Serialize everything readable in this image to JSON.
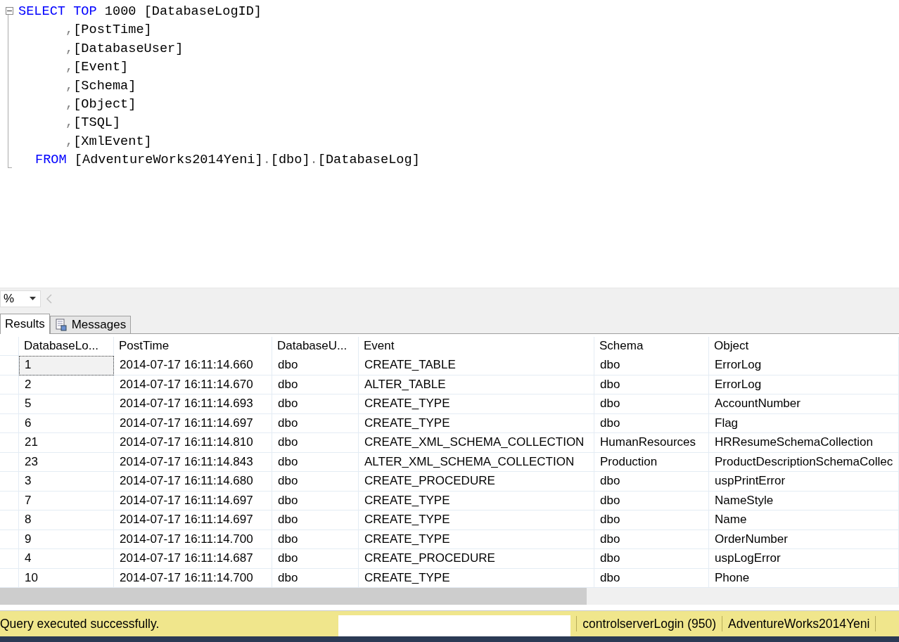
{
  "editor": {
    "lines": [
      {
        "kind": "head",
        "tokens": [
          {
            "kind": "keyword",
            "text": "SELECT"
          },
          {
            "kind": "keyword",
            "text": "TOP"
          },
          {
            "kind": "text",
            "text": "1000"
          },
          {
            "kind": "text",
            "text": "[DatabaseLogID]"
          }
        ]
      },
      {
        "kind": "column",
        "tokens": [
          {
            "kind": "punct",
            "text": ","
          },
          {
            "kind": "text",
            "text": "[PostTime]"
          }
        ]
      },
      {
        "kind": "column",
        "tokens": [
          {
            "kind": "punct",
            "text": ","
          },
          {
            "kind": "text",
            "text": "[DatabaseUser]"
          }
        ]
      },
      {
        "kind": "column",
        "tokens": [
          {
            "kind": "punct",
            "text": ","
          },
          {
            "kind": "text",
            "text": "[Event]"
          }
        ]
      },
      {
        "kind": "column",
        "tokens": [
          {
            "kind": "punct",
            "text": ","
          },
          {
            "kind": "text",
            "text": "[Schema]"
          }
        ]
      },
      {
        "kind": "column",
        "tokens": [
          {
            "kind": "punct",
            "text": ","
          },
          {
            "kind": "text",
            "text": "[Object]"
          }
        ]
      },
      {
        "kind": "column",
        "tokens": [
          {
            "kind": "punct",
            "text": ","
          },
          {
            "kind": "text",
            "text": "[TSQL]"
          }
        ]
      },
      {
        "kind": "column",
        "tokens": [
          {
            "kind": "punct",
            "text": ","
          },
          {
            "kind": "text",
            "text": "[XmlEvent]"
          }
        ]
      },
      {
        "kind": "from",
        "tokens": [
          {
            "kind": "keyword",
            "text": "FROM"
          },
          {
            "kind": "text",
            "text": "[AdventureWorks2014Yeni]"
          },
          {
            "kind": "punct",
            "text": "."
          },
          {
            "kind": "text",
            "text": "[dbo]"
          },
          {
            "kind": "punct",
            "text": "."
          },
          {
            "kind": "text",
            "text": "[DatabaseLog]"
          }
        ]
      }
    ],
    "expanded": true
  },
  "zoom": {
    "value": "%"
  },
  "tabs": [
    {
      "label": "Results",
      "selected": true,
      "kind": "grid"
    },
    {
      "label": "Messages",
      "selected": false,
      "kind": "messages"
    }
  ],
  "table": {
    "columns": [
      "DatabaseLo...",
      "PostTime",
      "DatabaseU...",
      "Event",
      "Schema",
      "Object"
    ],
    "rows": [
      {
        "selected": true,
        "cells": [
          "1",
          "2014-07-17 16:11:14.660",
          "dbo",
          "CREATE_TABLE",
          "dbo",
          "ErrorLog"
        ]
      },
      {
        "selected": false,
        "cells": [
          "2",
          "2014-07-17 16:11:14.670",
          "dbo",
          "ALTER_TABLE",
          "dbo",
          "ErrorLog"
        ]
      },
      {
        "selected": false,
        "cells": [
          "5",
          "2014-07-17 16:11:14.693",
          "dbo",
          "CREATE_TYPE",
          "dbo",
          "AccountNumber"
        ]
      },
      {
        "selected": false,
        "cells": [
          "6",
          "2014-07-17 16:11:14.697",
          "dbo",
          "CREATE_TYPE",
          "dbo",
          "Flag"
        ]
      },
      {
        "selected": false,
        "cells": [
          "21",
          "2014-07-17 16:11:14.810",
          "dbo",
          "CREATE_XML_SCHEMA_COLLECTION",
          "HumanResources",
          "HRResumeSchemaCollection"
        ]
      },
      {
        "selected": false,
        "cells": [
          "23",
          "2014-07-17 16:11:14.843",
          "dbo",
          "ALTER_XML_SCHEMA_COLLECTION",
          "Production",
          "ProductDescriptionSchemaCollec"
        ]
      },
      {
        "selected": false,
        "cells": [
          "3",
          "2014-07-17 16:11:14.680",
          "dbo",
          "CREATE_PROCEDURE",
          "dbo",
          "uspPrintError"
        ]
      },
      {
        "selected": false,
        "cells": [
          "7",
          "2014-07-17 16:11:14.697",
          "dbo",
          "CREATE_TYPE",
          "dbo",
          "NameStyle"
        ]
      },
      {
        "selected": false,
        "cells": [
          "8",
          "2014-07-17 16:11:14.697",
          "dbo",
          "CREATE_TYPE",
          "dbo",
          "Name"
        ]
      },
      {
        "selected": false,
        "cells": [
          "9",
          "2014-07-17 16:11:14.700",
          "dbo",
          "CREATE_TYPE",
          "dbo",
          "OrderNumber"
        ]
      },
      {
        "selected": false,
        "cells": [
          "4",
          "2014-07-17 16:11:14.687",
          "dbo",
          "CREATE_PROCEDURE",
          "dbo",
          "uspLogError"
        ]
      },
      {
        "selected": false,
        "cells": [
          "10",
          "2014-07-17 16:11:14.700",
          "dbo",
          "CREATE_TYPE",
          "dbo",
          "Phone"
        ]
      }
    ]
  },
  "status_bar": {
    "message": "Query executed successfully.",
    "login": "controlserverLogin (950)",
    "database": "AdventureWorks2014Yeni"
  }
}
